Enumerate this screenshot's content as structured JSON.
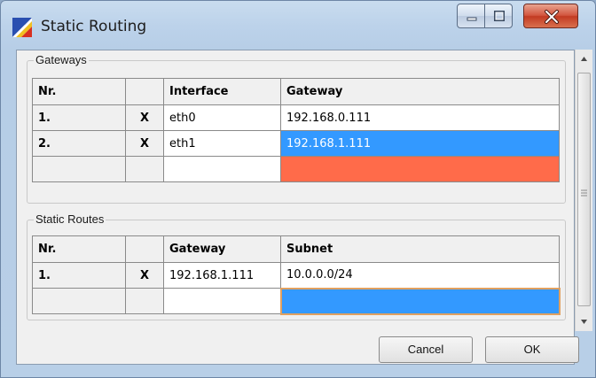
{
  "window": {
    "title": "Static Routing",
    "controls": [
      "minimize",
      "maximize",
      "close"
    ]
  },
  "gateways": {
    "legend": "Gateways",
    "columns": [
      "Nr.",
      "",
      "Interface",
      "Gateway"
    ],
    "rows": [
      {
        "nr": "1.",
        "del": "X",
        "interface": "eth0",
        "gateway": "192.168.0.111"
      },
      {
        "nr": "2.",
        "del": "X",
        "interface": "eth1",
        "gateway": "192.168.1.111"
      },
      {
        "nr": "",
        "del": "",
        "interface": "",
        "gateway": ""
      }
    ]
  },
  "routes": {
    "legend": "Static Routes",
    "columns": [
      "Nr.",
      "",
      "Gateway",
      "Subnet"
    ],
    "rows": [
      {
        "nr": "1.",
        "del": "X",
        "gateway": "192.168.1.111",
        "subnet": "10.0.0.0/24"
      },
      {
        "nr": "",
        "del": "",
        "gateway": "",
        "subnet": ""
      }
    ]
  },
  "buttons": {
    "cancel": "Cancel",
    "ok": "OK"
  },
  "colors": {
    "selection": "#3399ff",
    "error": "#ff6b4a"
  }
}
